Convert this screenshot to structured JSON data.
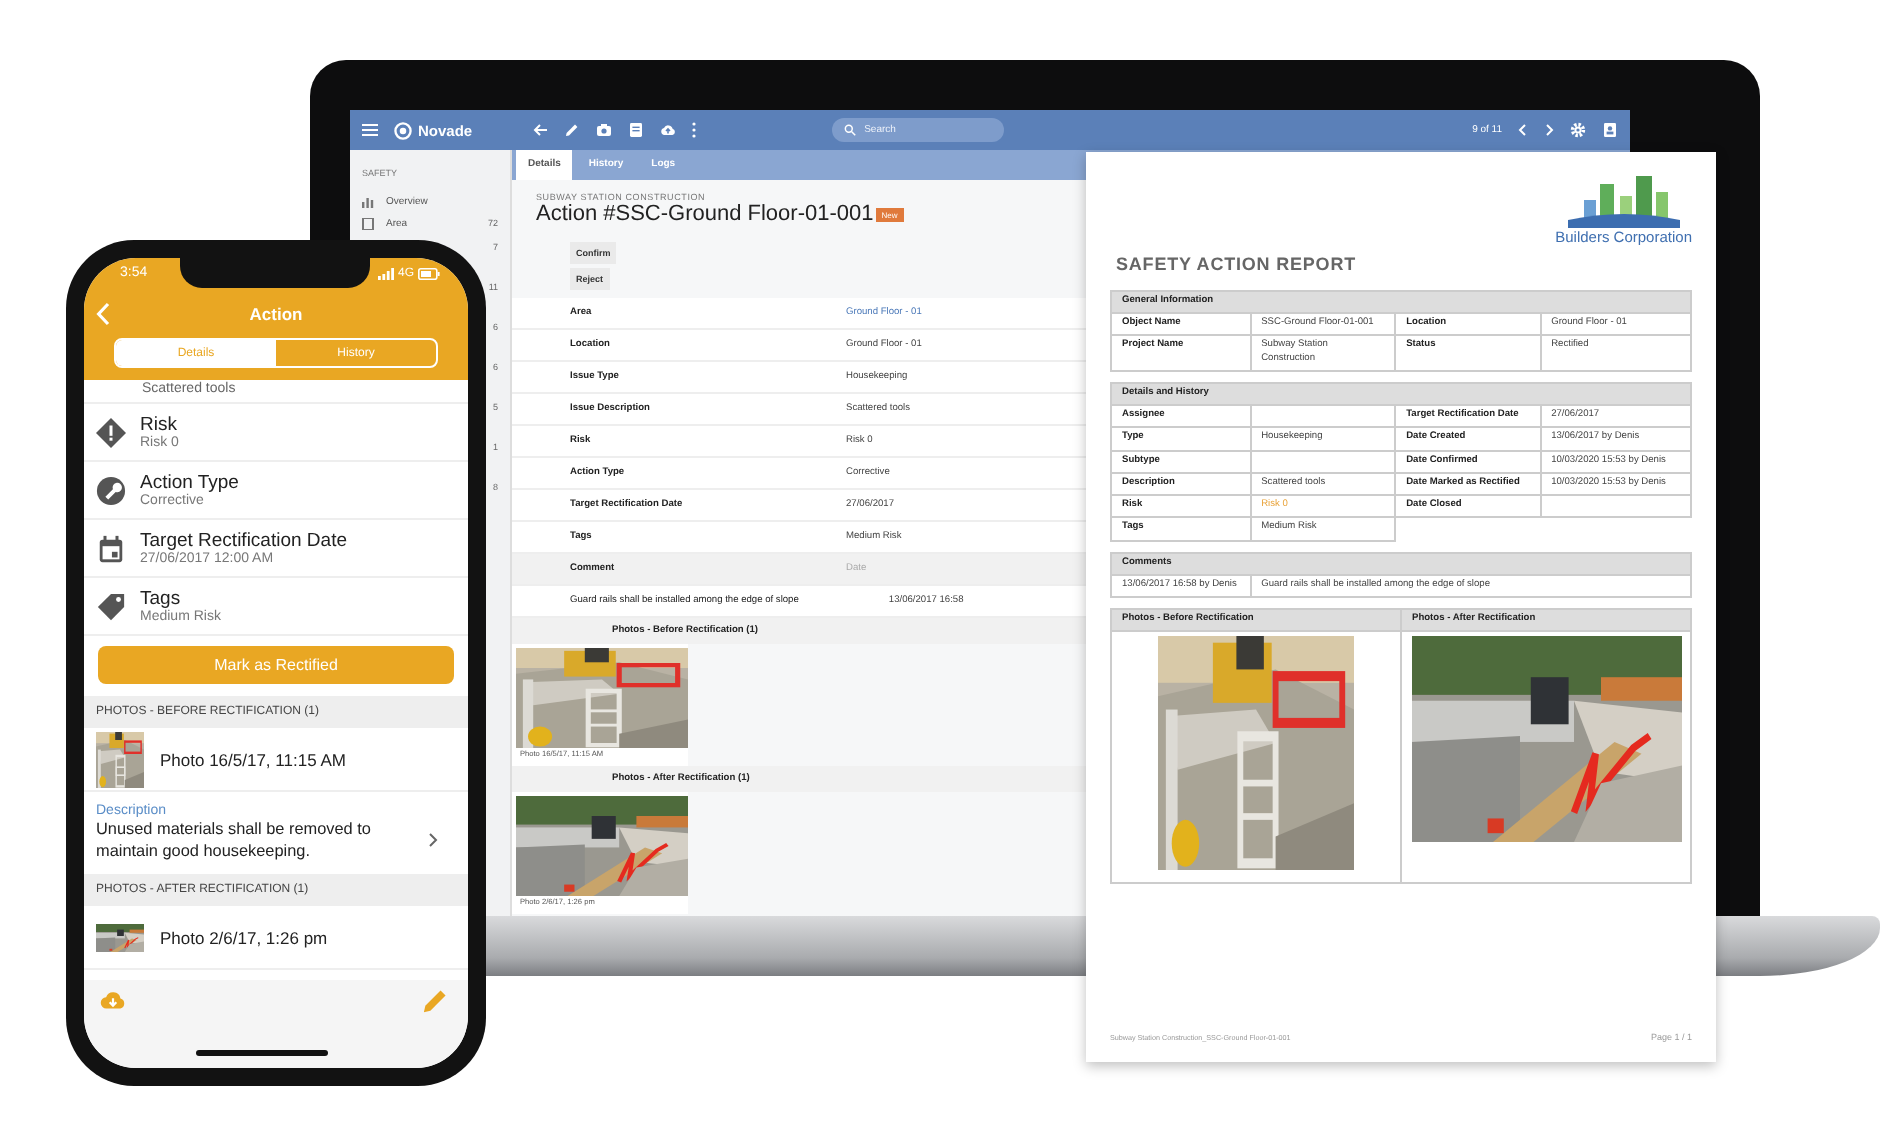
{
  "laptop": {
    "app_bar": {
      "brand": "Novade",
      "search": {
        "placeholder": "Search"
      },
      "pager": "9 of 11"
    },
    "sidebar": {
      "section": "SAFETY",
      "items": [
        {
          "label": "Overview"
        },
        {
          "label": "Area",
          "count": "72"
        }
      ],
      "counts": [
        "7",
        "11",
        "6",
        "6",
        "5",
        "1",
        "8"
      ]
    },
    "tabs": [
      {
        "label": "Details",
        "selected": true
      },
      {
        "label": "History",
        "selected": false
      },
      {
        "label": "Logs",
        "selected": false
      }
    ],
    "project": "SUBWAY STATION CONSTRUCTION",
    "title": "Action #SSC-Ground Floor-01-001",
    "badge": "New",
    "buttons": [
      "Confirm",
      "Reject"
    ],
    "fields": [
      {
        "label": "Area",
        "value": "Ground Floor - 01",
        "kind": "link"
      },
      {
        "label": "Location",
        "value": "Ground Floor - 01",
        "kind": "text"
      },
      {
        "label": "Issue Type",
        "value": "Housekeeping",
        "kind": "text"
      },
      {
        "label": "Issue Description",
        "value": "Scattered tools",
        "kind": "text"
      },
      {
        "label": "Risk",
        "value": "Risk 0",
        "kind": "text"
      },
      {
        "label": "Action Type",
        "value": "Corrective",
        "kind": "text"
      },
      {
        "label": "Target Rectification Date",
        "value": "27/06/2017",
        "kind": "text"
      },
      {
        "label": "Tags",
        "value": "Medium Risk",
        "kind": "text"
      }
    ],
    "comments": {
      "columns": [
        "Comment",
        "Date"
      ],
      "rows": [
        {
          "text": "Guard rails shall be installed among the edge of slope",
          "date": "13/06/2017 16:58"
        }
      ]
    },
    "photo_sections": [
      {
        "title": "Photos - Before Rectification (1)",
        "caption": "Photo 16/5/17, 11:15 AM"
      },
      {
        "title": "Photos - After Rectification (1)",
        "caption": "Photo 2/6/17, 1:26 pm"
      }
    ]
  },
  "report": {
    "company": "Builders Corporation",
    "title": "SAFETY ACTION REPORT",
    "sections": [
      {
        "title": "General Information",
        "rows": [
          {
            "cells": [
              {
                "label": "Object Name",
                "value": "SSC-Ground Floor-01-001"
              },
              {
                "label": "Location",
                "value": "Ground Floor - 01"
              }
            ]
          },
          {
            "cells": [
              {
                "label": "Project Name",
                "value": "Subway Station Construction"
              },
              {
                "label": "Status",
                "value": "Rectified"
              }
            ]
          }
        ]
      },
      {
        "title": "Details and History",
        "rows": [
          {
            "cells": [
              {
                "label": "Assignee"
              },
              {
                "label": "Target Rectification Date",
                "value": "27/06/2017"
              }
            ]
          },
          {
            "cells": [
              {
                "label": "Type",
                "value": "Housekeeping"
              },
              {
                "label": "Date Created",
                "value": "13/06/2017 by Denis"
              }
            ]
          },
          {
            "cells": [
              {
                "label": "Subtype"
              },
              {
                "label": "Date Confirmed",
                "value": "10/03/2020 15:53 by Denis"
              }
            ]
          },
          {
            "cells": [
              {
                "label": "Description",
                "value": "Scattered tools"
              },
              {
                "label": "Date Marked as Rectified",
                "value": "10/03/2020 15:53 by Denis"
              }
            ]
          },
          {
            "cells": [
              {
                "label": "Risk",
                "value": "Risk 0",
                "highlighted": true
              },
              {
                "label": "Date Closed"
              }
            ]
          },
          {
            "cells": [
              {
                "label": "Tags",
                "value": "Medium Risk"
              }
            ]
          }
        ]
      }
    ],
    "comments": {
      "title": "Comments",
      "rows": [
        {
          "author": "13/06/2017 16:58 by Denis",
          "text": "Guard rails shall be installed among the edge of slope"
        }
      ]
    },
    "photo_columns": [
      "Photos - Before Rectification",
      "Photos - After Rectification"
    ],
    "footer": "Subway Station Construction_SSC-Ground Floor-01-001",
    "page": "Page 1 / 1"
  },
  "phone": {
    "time": "3:54",
    "network": "4G",
    "title": "Action",
    "segments": [
      {
        "label": "Details",
        "selected": true
      },
      {
        "label": "History",
        "selected": false
      }
    ],
    "partial": "Scattered tools",
    "items": [
      {
        "kind": "risk",
        "title": "Risk",
        "subtitle": "Risk 0"
      },
      {
        "kind": "action",
        "title": "Action Type",
        "subtitle": "Corrective"
      },
      {
        "kind": "date",
        "title": "Target Rectification Date",
        "subtitle": "27/06/2017 12:00 AM"
      },
      {
        "kind": "tag",
        "title": "Tags",
        "subtitle": "Medium Risk"
      }
    ],
    "button": "Mark as Rectified",
    "sections": [
      {
        "title": "PHOTOS - BEFORE RECTIFICATION (1)",
        "photo": "Photo 16/5/17, 11:15 AM",
        "description_label": "Description",
        "description": "Unused materials shall be removed to maintain good housekeeping."
      },
      {
        "title": "PHOTOS - AFTER RECTIFICATION (1)",
        "photo": "Photo 2/6/17, 1:26 pm"
      }
    ]
  }
}
